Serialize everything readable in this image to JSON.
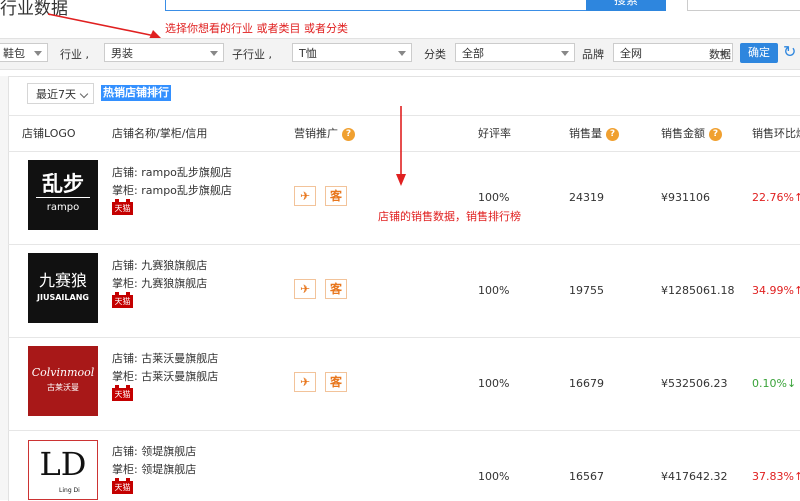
{
  "page": {
    "heading": "行业数据",
    "search_button": "搜索",
    "annotation_top": "选择你想看的行业  或者类目   或者分类",
    "annotation_table": "店铺的销售数据，销售排行榜"
  },
  "filters": {
    "first_select": "鞋包",
    "industry_label": "行业",
    "industry_value": "男装",
    "sub_industry_label": "子行业",
    "sub_industry_value": "T恤",
    "category_label": "分类",
    "category_value": "全部",
    "brand_label": "品牌",
    "brand_value": "全网",
    "data_label": "数据",
    "confirm_label": "确定"
  },
  "panel": {
    "period": "最近7天",
    "tab_hot": "热销店铺排行"
  },
  "table": {
    "headers": {
      "logo": "店铺LOGO",
      "name": "店铺名称/掌柜/信用",
      "promo": "营销推广",
      "rating": "好评率",
      "sales": "销售量",
      "amount": "销售金额",
      "ratio": "销售环比爆"
    },
    "shop_prefix": "店铺:",
    "keeper_prefix": "掌柜:",
    "tmall_badge": "天猫",
    "promo_ke": "客",
    "rows": [
      {
        "logo_main": "乱步",
        "logo_sub": "rampo",
        "shop": "rampo乱步旗舰店",
        "keeper": "rampo乱步旗舰店",
        "rating": "100%",
        "sales": "24319",
        "amount": "¥931106",
        "ratio": "22.76%",
        "trend": "up"
      },
      {
        "logo_main": "九赛狼",
        "logo_sub": "JIUSAILANG",
        "shop": "九赛狼旗舰店",
        "keeper": "九赛狼旗舰店",
        "rating": "100%",
        "sales": "19755",
        "amount": "¥1285061.18",
        "ratio": "34.99%",
        "trend": "up"
      },
      {
        "logo_main": "Colvinmool",
        "logo_sub": "古莱沃曼",
        "shop": "古莱沃曼旗舰店",
        "keeper": "古莱沃曼旗舰店",
        "rating": "100%",
        "sales": "16679",
        "amount": "¥532506.23",
        "ratio": "0.10%",
        "trend": "down"
      },
      {
        "logo_main": "LD",
        "logo_sub": "Ling Di",
        "shop": "领堤旗舰店",
        "keeper": "领堤旗舰店",
        "rating": "100%",
        "sales": "16567",
        "amount": "¥417642.32",
        "ratio": "37.83%",
        "trend": "up"
      }
    ]
  },
  "colors": {
    "accent": "#2e86de",
    "annotation": "#e02020",
    "up": "#e02020",
    "down": "#3aa33a"
  }
}
